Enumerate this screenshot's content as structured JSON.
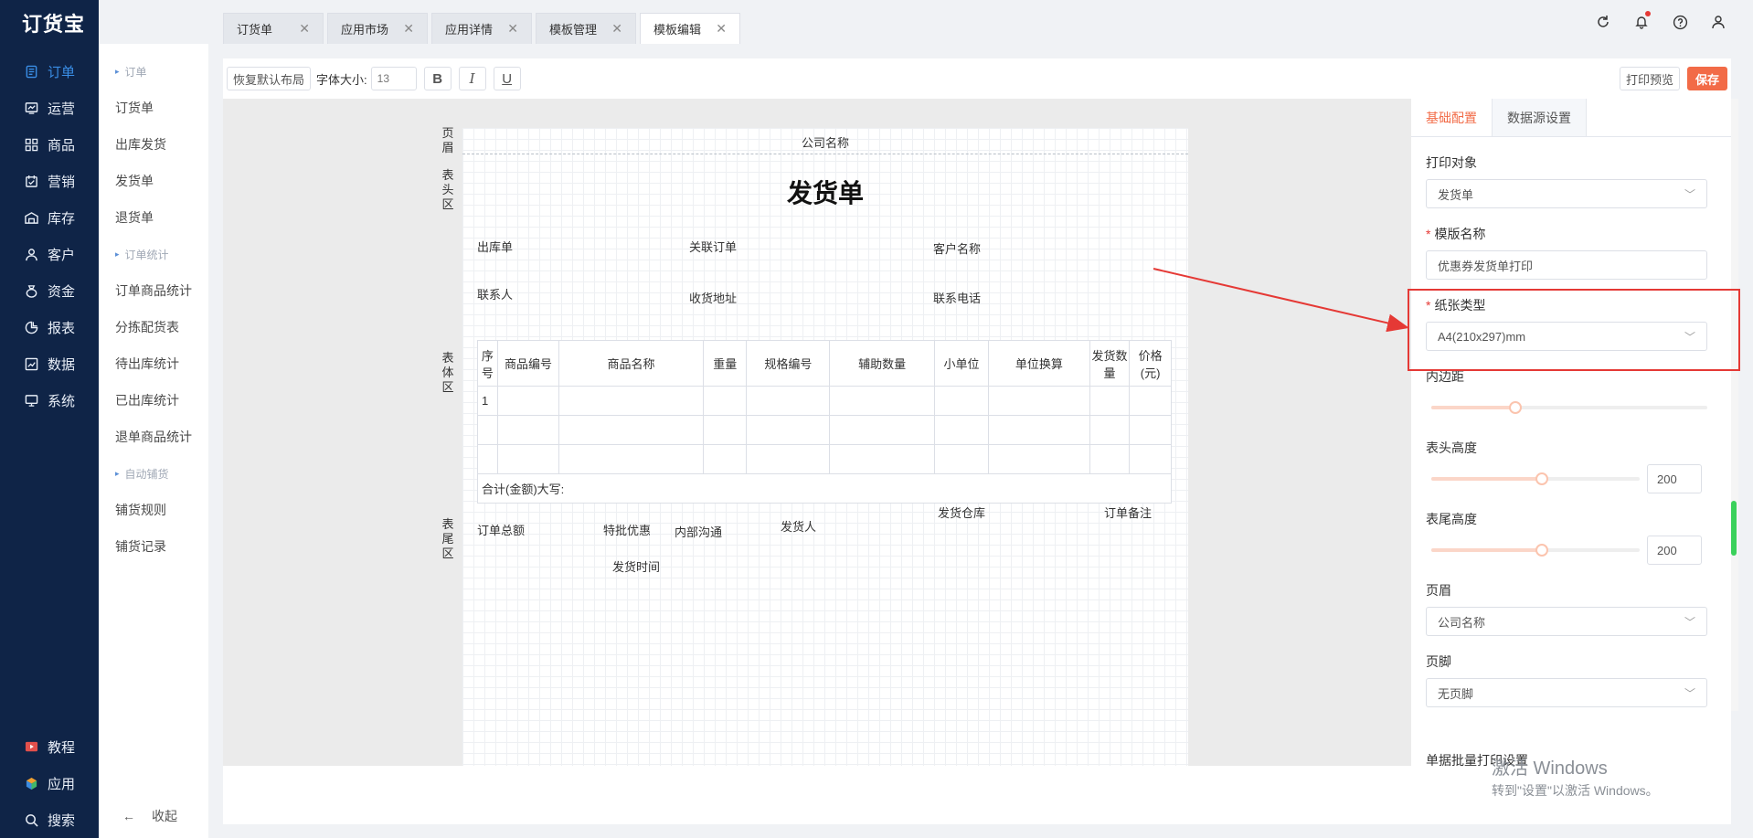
{
  "app": {
    "logo": "订货宝"
  },
  "nav": {
    "items": [
      {
        "label": "订单",
        "icon": "order-icon",
        "active": true
      },
      {
        "label": "运营",
        "icon": "operation-icon"
      },
      {
        "label": "商品",
        "icon": "goods-icon"
      },
      {
        "label": "营销",
        "icon": "marketing-icon"
      },
      {
        "label": "库存",
        "icon": "inventory-icon"
      },
      {
        "label": "客户",
        "icon": "customer-icon"
      },
      {
        "label": "资金",
        "icon": "money-icon"
      },
      {
        "label": "报表",
        "icon": "report-icon"
      },
      {
        "label": "数据",
        "icon": "data-icon"
      },
      {
        "label": "系统",
        "icon": "system-icon"
      }
    ],
    "bottom": [
      {
        "label": "教程",
        "icon": "tutorial-icon"
      },
      {
        "label": "应用",
        "icon": "apps-icon"
      },
      {
        "label": "搜索",
        "icon": "search-icon"
      }
    ]
  },
  "subnav": {
    "group1": "订单",
    "items1": [
      "订货单",
      "出库发货",
      "发货单",
      "退货单"
    ],
    "group2": "订单统计",
    "items2": [
      "订单商品统计",
      "分拣配货表",
      "待出库统计",
      "已出库统计",
      "退单商品统计"
    ],
    "group3": "自动铺货",
    "items3": [
      "铺货规则",
      "铺货记录"
    ],
    "collapse": "收起"
  },
  "tabs": [
    {
      "label": "订货单"
    },
    {
      "label": "应用市场"
    },
    {
      "label": "应用详情"
    },
    {
      "label": "模板管理"
    },
    {
      "label": "模板编辑",
      "active": true
    }
  ],
  "toolbar": {
    "restore": "恢复默认布局",
    "font_size_label": "字体大小:",
    "font_size": "13",
    "bold": "B",
    "italic": "I",
    "underline": "U",
    "preview": "打印预览",
    "save": "保存"
  },
  "canvas": {
    "region_header": "页眉",
    "region_top": "表头区",
    "region_body": "表体区",
    "region_tail": "表尾区",
    "company": "公司名称",
    "title": "发货单",
    "fields": {
      "outbound": "出库单",
      "related_order": "关联订单",
      "customer": "客户名称",
      "contact": "联系人",
      "address": "收货地址",
      "phone": "联系电话",
      "order_total": "订单总额",
      "special_discount": "特批优惠",
      "internal_note": "内部沟通",
      "shipper": "发货人",
      "warehouse": "发货仓库",
      "order_remark": "订单备注",
      "ship_time": "发货时间"
    },
    "table": {
      "headers": [
        "序号",
        "商品编号",
        "商品名称",
        "重量",
        "规格编号",
        "辅助数量",
        "小单位",
        "单位换算",
        "发货数量",
        "价格(元)"
      ],
      "first_index": "1",
      "total_label": "合计(金额)大写:"
    }
  },
  "panel": {
    "tab_basic": "基础配置",
    "tab_datasource": "数据源设置",
    "print_target_label": "打印对象",
    "print_target": "发货单",
    "template_name_label": "模版名称",
    "template_name": "优惠券发货单打印",
    "paper_type_label": "纸张类型",
    "paper_type": "A4(210x297)mm",
    "padding_label": "内边距",
    "padding_level": 0.3,
    "header_height_label": "表头高度",
    "header_height": "200",
    "header_height_level": 0.53,
    "footer_height_label": "表尾高度",
    "footer_height": "200",
    "footer_height_level": 0.53,
    "page_header_label": "页眉",
    "page_header": "公司名称",
    "page_footer_label": "页脚",
    "page_footer": "无页脚",
    "cut_label": "单据批量打印设置"
  },
  "watermark": {
    "line1": "激活 Windows",
    "line2": "转到\"设置\"以激活 Windows。"
  },
  "colors": {
    "nav_bg": "#0f2447",
    "accent": "#f26b47",
    "highlight": "#e53935",
    "active_nav": "#3a8ee6"
  }
}
